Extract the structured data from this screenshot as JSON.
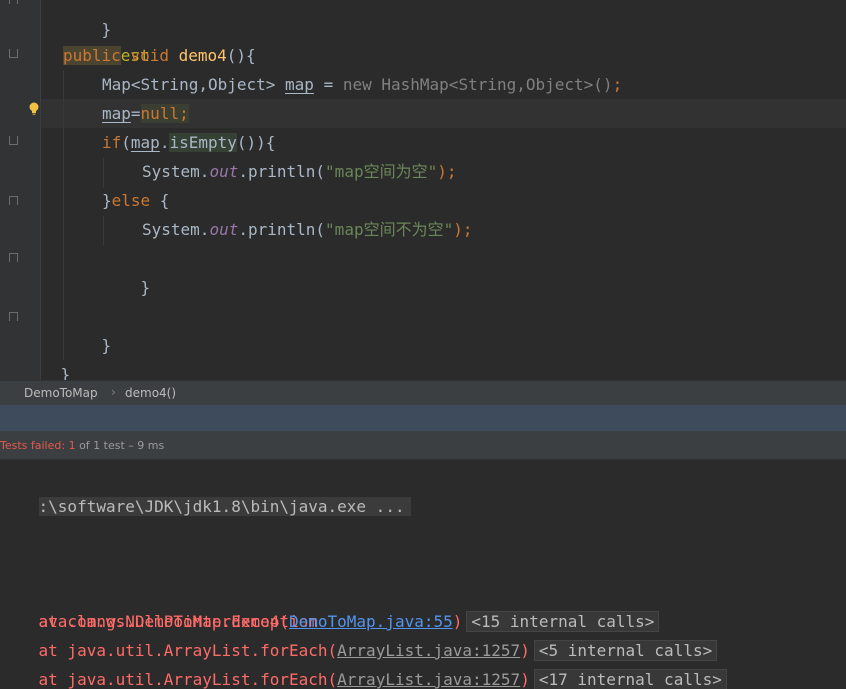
{
  "editor": {
    "lines": {
      "annotation": "@Test",
      "sig_public": "public",
      "sig_void": " void ",
      "sig_name": "demo4",
      "sig_paren": "(){",
      "map_type": "Map<String,Object> ",
      "map_var": "map",
      "map_eq": " = ",
      "map_new": "new HashMap<String,Object>()",
      "map_semi": ";",
      "null_var": "map",
      "null_eq": "=",
      "null_val": "null",
      "null_semi": ";",
      "if_kw": "if",
      "if_open": "(",
      "if_var": "map",
      "if_dot": ".",
      "if_call": "isEmpty",
      "if_close": "()){",
      "print1_sys": "System.",
      "print1_out": "out",
      "print1_call": ".println(",
      "print1_str": "\"map空间为空\"",
      "print1_end": ");",
      "else_open": "}",
      "else_kw": "else",
      "else_brace": " {",
      "print2_sys": "System.",
      "print2_out": "out",
      "print2_call": ".println(",
      "print2_str": "\"map空间不为空\"",
      "print2_end": ");",
      "close_inner": "}",
      "close_method": "}",
      "close_class": "}",
      "top_brace": "}"
    }
  },
  "breadcrumb": {
    "class_name": "DemoToMap",
    "separator": "›",
    "method_name": "demo4()"
  },
  "status": {
    "failed_label": "Tests failed: 1",
    "rest": " of 1 test – 9 ms"
  },
  "console": {
    "command": ":\\software\\JDK\\jdk1.8\\bin\\java.exe ...",
    "exception": "ava.lang.NullPointerException",
    "frames": [
      {
        "prefix": "    at com.ws.DemoToMap.demo4(",
        "link": "DemoToMap.java:55",
        "suffix": ")",
        "internal": "<15 internal calls>"
      },
      {
        "prefix": "    at java.util.ArrayList.forEach(",
        "link": "ArrayList.java:1257",
        "suffix": ")",
        "internal": "<5 internal calls>"
      },
      {
        "prefix": "    at java.util.ArrayList.forEach(",
        "link": "ArrayList.java:1257",
        "suffix": ")",
        "internal": "<17 internal calls>"
      }
    ]
  },
  "colors": {
    "keyword": "#cc7832",
    "annotation": "#bbb529",
    "string": "#6a8759",
    "error": "#ff6b68",
    "link": "#5394ec"
  },
  "icons": {
    "bulb": "lightbulb-icon",
    "fold": "fold-marker-icon"
  }
}
